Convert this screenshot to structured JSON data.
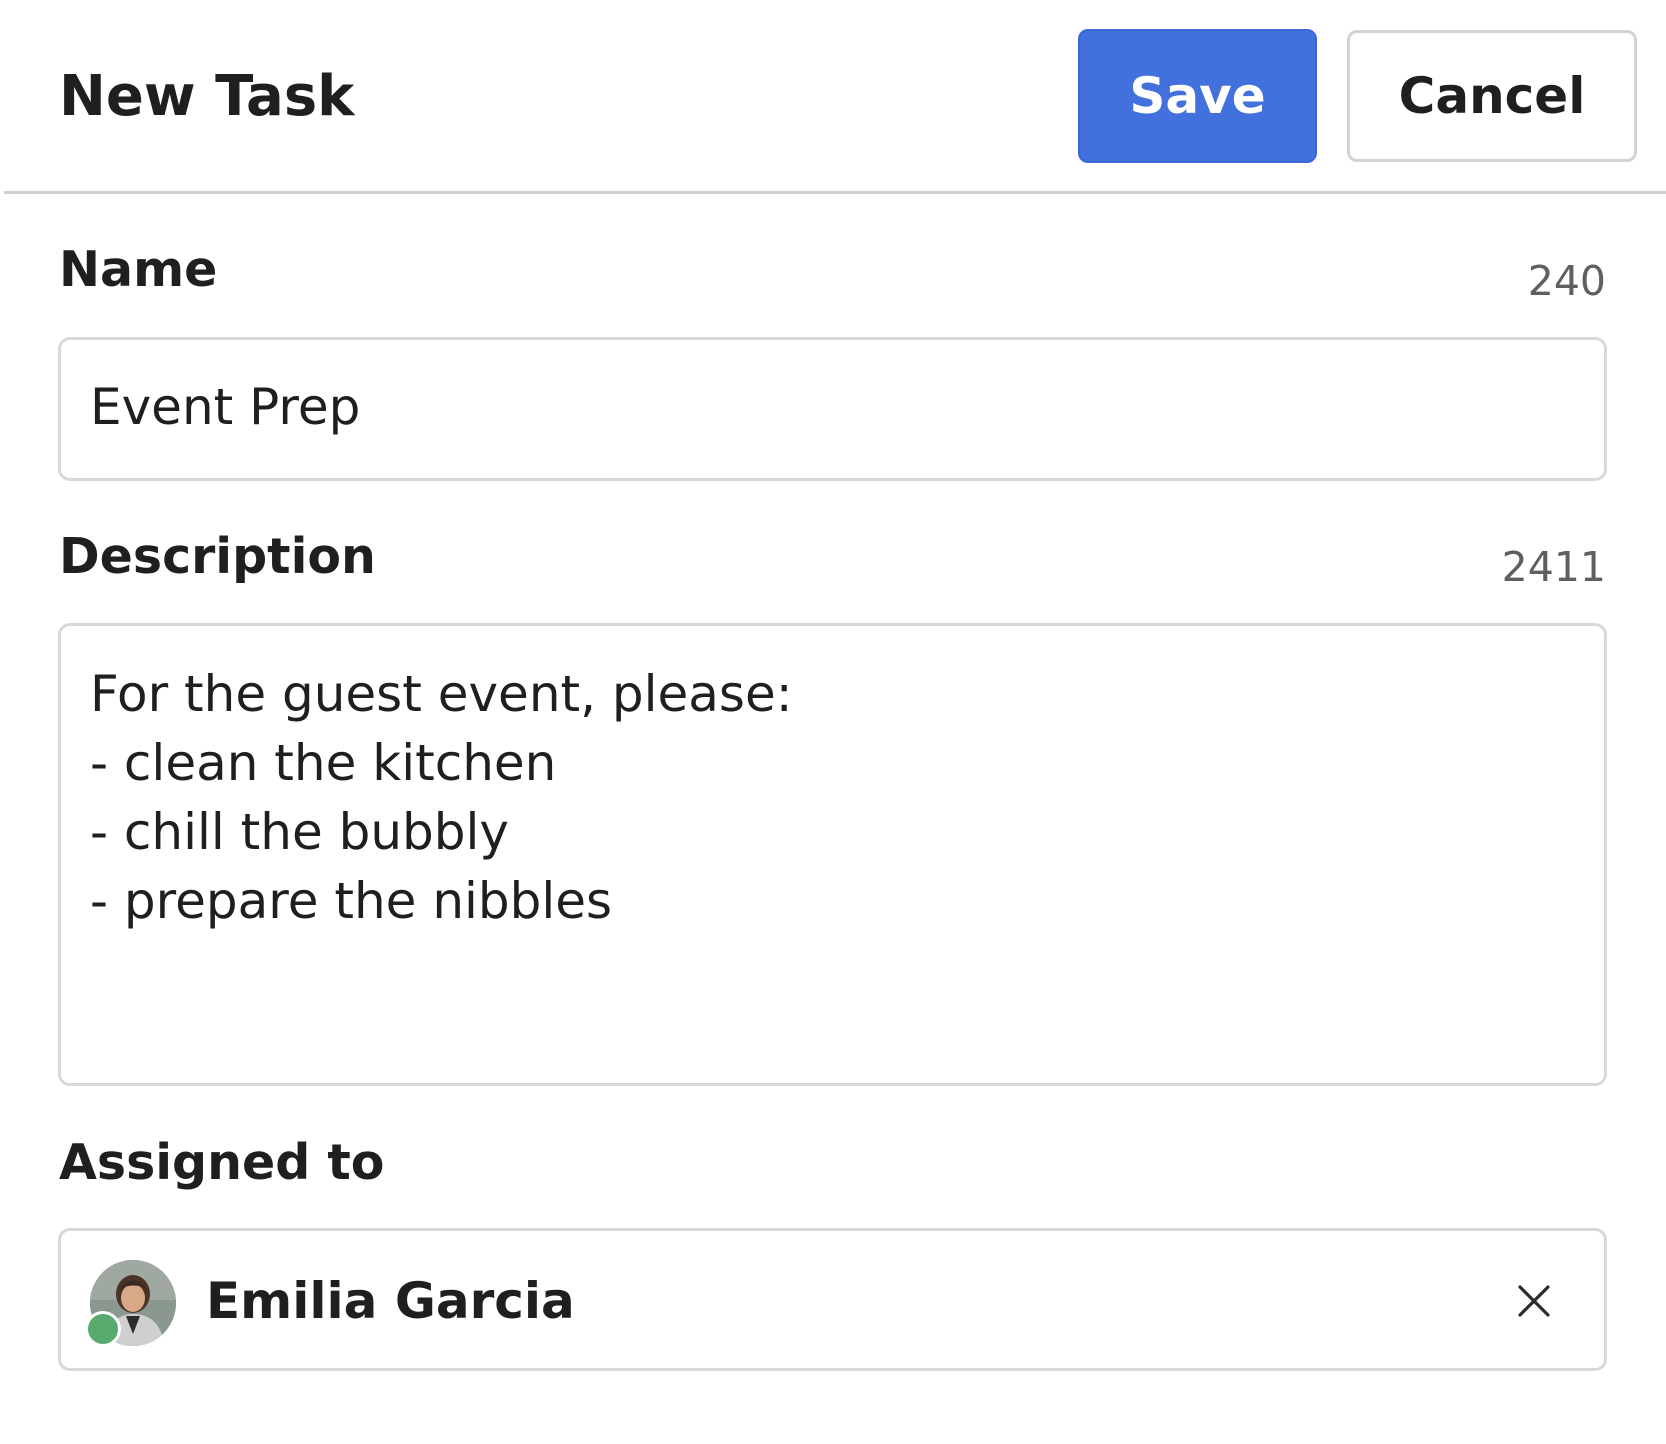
{
  "header": {
    "title": "New Task",
    "save_label": "Save",
    "cancel_label": "Cancel"
  },
  "form": {
    "name": {
      "label": "Name",
      "counter": "240",
      "value": "Event Prep"
    },
    "description": {
      "label": "Description",
      "counter": "2411",
      "value": "For the guest event, please:\n- clean the kitchen\n- chill the bubbly\n- prepare the nibbles"
    },
    "assigned_to": {
      "label": "Assigned to",
      "assignee_name": "Emilia Garcia",
      "avatar_icon": "user-photo-avatar",
      "status": "online",
      "clear_icon": "close-icon"
    }
  },
  "colors": {
    "primary": "#4270dd",
    "border": "#d8d8d8",
    "status_online": "#58aa6e",
    "text": "#1f1f1f",
    "muted_text": "#5f5f5f"
  }
}
